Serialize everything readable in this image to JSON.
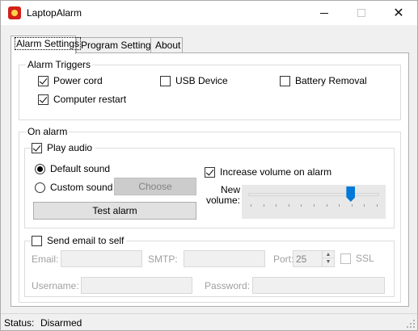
{
  "window": {
    "title": "LaptopAlarm",
    "app_icon": "alarm-app-icon",
    "controls": [
      "minimize",
      "maximize",
      "close"
    ],
    "close_glyph": "✕"
  },
  "tabs": [
    {
      "label": "Alarm Settings",
      "active": true
    },
    {
      "label": "Program Settings",
      "active": false
    },
    {
      "label": "About",
      "active": false
    }
  ],
  "alarm_triggers": {
    "title": "Alarm Triggers",
    "items": [
      {
        "label": "Power cord",
        "checked": true
      },
      {
        "label": "USB Device",
        "checked": false
      },
      {
        "label": "Battery Removal",
        "checked": false
      },
      {
        "label": "Computer restart",
        "checked": true
      }
    ]
  },
  "on_alarm": {
    "title": "On alarm",
    "play_audio": {
      "label": "Play audio",
      "checked": true
    },
    "default_sound": {
      "label": "Default sound",
      "selected": true
    },
    "custom_sound": {
      "label": "Custom sound",
      "selected": false
    },
    "choose_button": "Choose",
    "test_button": "Test alarm",
    "increase_volume": {
      "label": "Increase volume on alarm",
      "checked": true
    },
    "new_volume_label_1": "New",
    "new_volume_label_2": "volume:",
    "new_volume_fraction": 0.78,
    "send_email": {
      "label": "Send email to self",
      "checked": false
    },
    "email_label": "Email:",
    "email_value": "",
    "smtp_label": "SMTP:",
    "smtp_value": "",
    "port_label": "Port:",
    "port_value": "25",
    "ssl": {
      "label": "SSL",
      "checked": false
    },
    "username_label": "Username:",
    "username_value": "",
    "password_label": "Password:",
    "password_value": ""
  },
  "status": {
    "label": "Status:",
    "value": "Disarmed"
  }
}
